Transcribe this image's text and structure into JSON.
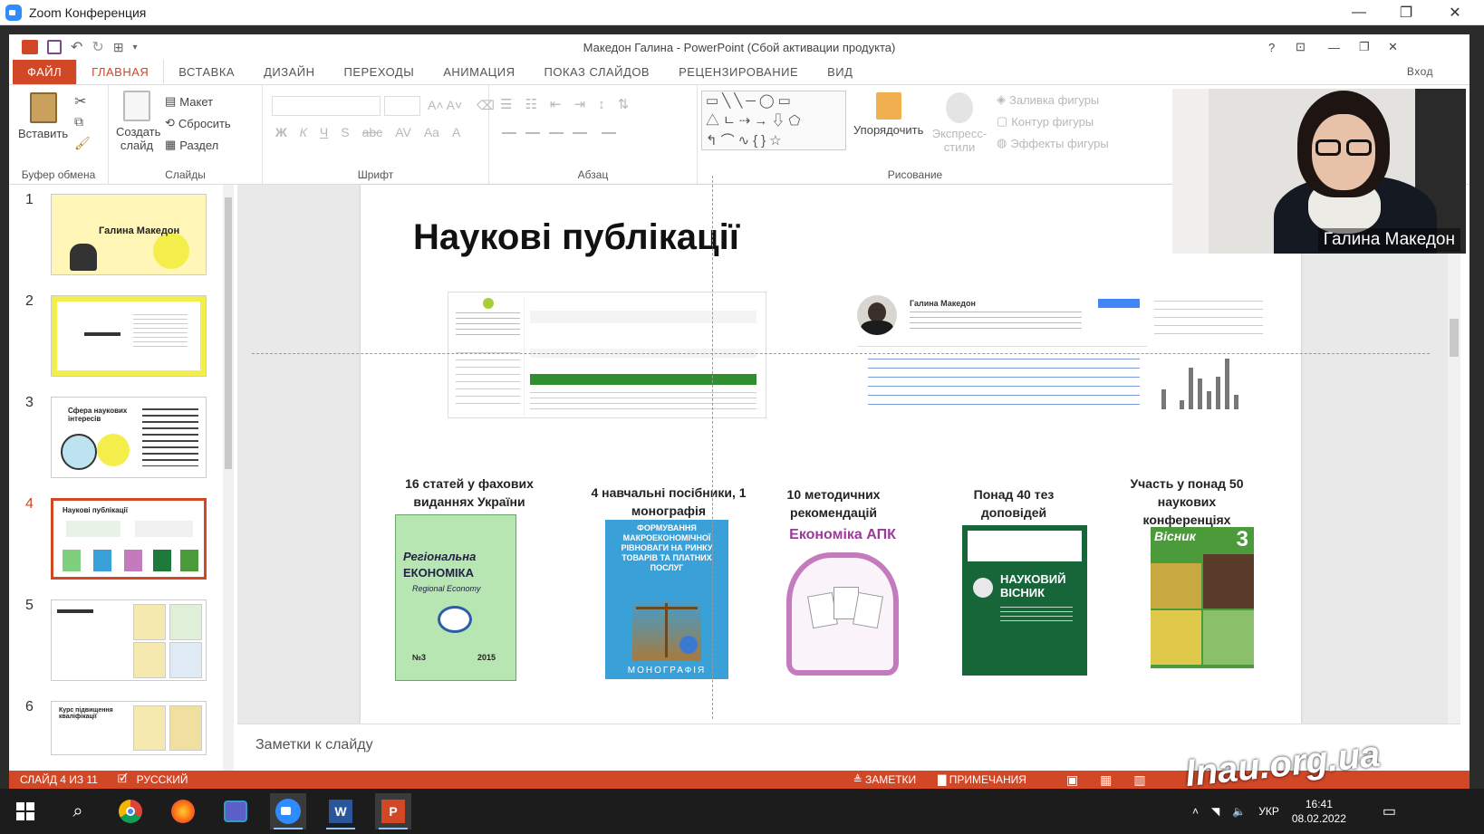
{
  "zoom": {
    "title": "Zoom Конференция",
    "minimize": "—",
    "restore": "❐",
    "close": "✕"
  },
  "ppt": {
    "title": "Македон Галина - PowerPoint (Сбой активации продукта)",
    "help": "?",
    "ribbon_opts": "⊡",
    "min": "—",
    "restore": "❐",
    "close": "✕",
    "signin": "Вход"
  },
  "tabs": [
    "ФАЙЛ",
    "ГЛАВНАЯ",
    "ВСТАВКА",
    "ДИЗАЙН",
    "ПЕРЕХОДЫ",
    "АНИМАЦИЯ",
    "ПОКАЗ СЛАЙДОВ",
    "РЕЦЕНЗИРОВАНИЕ",
    "ВИД"
  ],
  "ribbon": {
    "clipboard": {
      "paste": "Вставить",
      "label": "Буфер обмена"
    },
    "slides": {
      "new_slide": "Создать слайд",
      "layout": "Макет",
      "reset": "Сбросить",
      "section": "Раздел",
      "label": "Слайды"
    },
    "font": {
      "label": "Шрифт",
      "bold": "Ж",
      "italic": "К",
      "underline": "Ч",
      "shadow": "S",
      "strike": "abc",
      "spacing": "AV",
      "case": "Aa"
    },
    "paragraph": {
      "label": "Абзац"
    },
    "drawing": {
      "arrange": "Упорядочить",
      "quick_styles": "Экспресс-стили",
      "fill": "Заливка фигуры",
      "outline": "Контур фигуры",
      "effects": "Эффекты фигуры",
      "label": "Рисование"
    }
  },
  "thumbnails": [
    {
      "num": "1",
      "text": "Галина Македон"
    },
    {
      "num": "2",
      "text": ""
    },
    {
      "num": "3",
      "text": "Сфера наукових інтересів"
    },
    {
      "num": "4",
      "text": "Наукові публікації"
    },
    {
      "num": "5",
      "text": ""
    },
    {
      "num": "6",
      "text": "Курс підвищення кваліфікації"
    }
  ],
  "slide": {
    "title": "Наукові публікації",
    "profile_name": "Галина Македон",
    "stats": [
      "16 статей у фахових виданнях України",
      "4 навчальні посібники, 1 монографія",
      "10 методичних рекомендацій",
      "Понад 40 тез доповідей",
      "Участь у понад 50 наукових конференціях"
    ],
    "covers": {
      "c1": {
        "line1": "Регіональна",
        "line2": "ЕКОНОМІКА",
        "line3": "Regional Economy",
        "issue": "№3",
        "year": "2015"
      },
      "c2": {
        "top": "ФОРМУВАННЯ МАКРОЕКОНОМІЧНОЇ РІВНОВАГИ НА РИНКУ ТОВАРІВ ТА ПЛАТНИХ ПОСЛУГ",
        "bottom": "МОНОГРАФІЯ"
      },
      "c3": {
        "title": "Економіка АПК"
      },
      "c4": {
        "title": "НАУКОВИЙ ВІСНИК"
      },
      "c5": {
        "title": "Вісник",
        "num": "3"
      }
    }
  },
  "notes_placeholder": "Заметки к слайду",
  "status": {
    "slide": "СЛАЙД 4 ИЗ 11",
    "lang": "РУССКИЙ",
    "notes": "ЗАМЕТКИ",
    "comments": "ПРИМЕЧАНИЯ"
  },
  "camera": {
    "name": "Галина Македон"
  },
  "tray": {
    "lang": "УКР",
    "time": "16:41",
    "date": "08.02.2022"
  },
  "watermark": "lnau.org.ua",
  "colors": {
    "accent": "#d24726",
    "yellow": "#f3ee4a",
    "green": "#2f8f2f"
  }
}
